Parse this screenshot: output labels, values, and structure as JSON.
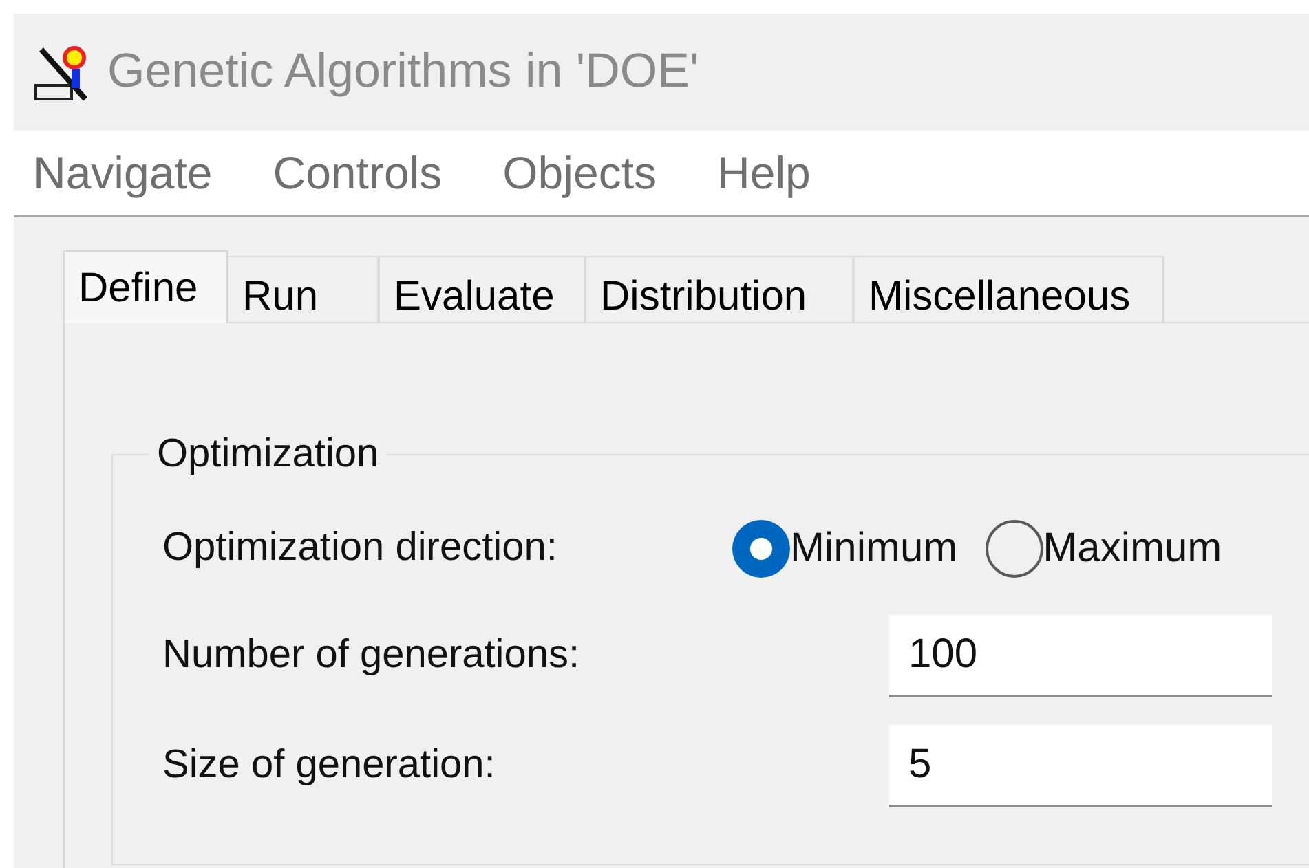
{
  "window": {
    "title": "Genetic Algorithms in 'DOE'"
  },
  "menu": [
    "Navigate",
    "Controls",
    "Objects",
    "Help"
  ],
  "tabs": [
    {
      "label": "Define",
      "selected": true
    },
    {
      "label": "Run",
      "selected": false
    },
    {
      "label": "Evaluate",
      "selected": false
    },
    {
      "label": "Distribution",
      "selected": false
    },
    {
      "label": "Miscellaneous",
      "selected": false
    }
  ],
  "group": {
    "title": "Optimization",
    "direction": {
      "label": "Optimization direction:",
      "options": [
        {
          "label": "Minimum",
          "selected": true
        },
        {
          "label": "Maximum",
          "selected": false
        }
      ]
    },
    "fields": [
      {
        "label": "Number of generations:",
        "value": "100"
      },
      {
        "label": "Size of generation:",
        "value": "5"
      }
    ]
  }
}
